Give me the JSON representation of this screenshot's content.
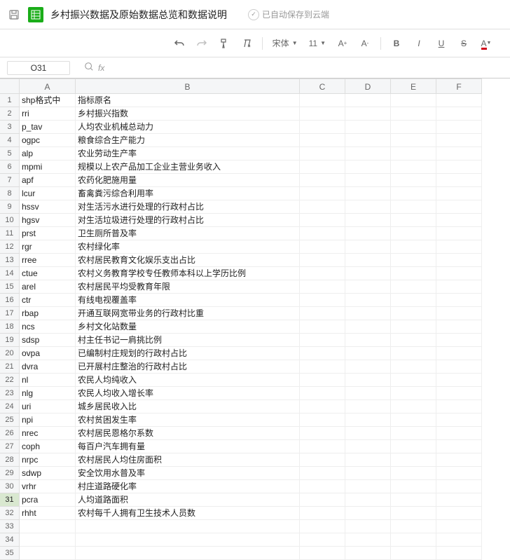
{
  "header": {
    "title": "乡村振兴数据及原始数据总览和数据说明",
    "cloud_status": "已自动保存到云端"
  },
  "toolbar": {
    "font_name": "宋体",
    "font_size": "11"
  },
  "formula_bar": {
    "cell_ref": "O31",
    "fx": "fx"
  },
  "columns": [
    "A",
    "B",
    "C",
    "D",
    "E",
    "F"
  ],
  "active_row": 31,
  "num_display_rows": 35,
  "rows": [
    {
      "a": "shp格式中",
      "b": "指标原名"
    },
    {
      "a": "rri",
      "b": "乡村振兴指数"
    },
    {
      "a": "p_tav",
      "b": "人均农业机械总动力"
    },
    {
      "a": "ogpc",
      "b": "粮食综合生产能力"
    },
    {
      "a": "alp",
      "b": "农业劳动生产率"
    },
    {
      "a": "mpmi",
      "b": "规模以上农产品加工企业主营业务收入"
    },
    {
      "a": "apf",
      "b": "农药化肥施用量"
    },
    {
      "a": "lcur",
      "b": "畜禽粪污综合利用率"
    },
    {
      "a": "hssv",
      "b": "对生活污水进行处理的行政村占比"
    },
    {
      "a": "hgsv",
      "b": "对生活垃圾进行处理的行政村占比"
    },
    {
      "a": "prst",
      "b": "卫生厕所普及率"
    },
    {
      "a": "rgr",
      "b": "农村绿化率"
    },
    {
      "a": "rree",
      "b": "农村居民教育文化娱乐支出占比"
    },
    {
      "a": "ctue",
      "b": "农村义务教育学校专任教师本科以上学历比例"
    },
    {
      "a": "arel",
      "b": "农村居民平均受教育年限"
    },
    {
      "a": "ctr",
      "b": "有线电视覆盖率"
    },
    {
      "a": "rbap",
      "b": "开通互联网宽带业务的行政村比重"
    },
    {
      "a": "ncs",
      "b": "乡村文化站数量"
    },
    {
      "a": "sdsp",
      "b": "村主任书记一肩挑比例"
    },
    {
      "a": "ovpa",
      "b": "已编制村庄规划的行政村占比"
    },
    {
      "a": "dvra",
      "b": "已开展村庄整治的行政村占比"
    },
    {
      "a": "nl",
      "b": "农民人均纯收入"
    },
    {
      "a": "nlg",
      "b": "农民人均收入增长率"
    },
    {
      "a": "uri",
      "b": "城乡居民收入比"
    },
    {
      "a": "npi",
      "b": "农村贫困发生率"
    },
    {
      "a": "nrec",
      "b": "农村居民恩格尔系数"
    },
    {
      "a": "coph",
      "b": "每百户汽车拥有量"
    },
    {
      "a": "nrpc",
      "b": "农村居民人均住房面积"
    },
    {
      "a": "sdwp",
      "b": "安全饮用水普及率"
    },
    {
      "a": "vrhr",
      "b": "村庄道路硬化率"
    },
    {
      "a": "pcra",
      "b": "人均道路面积"
    },
    {
      "a": "rhht",
      "b": "农村每千人拥有卫生技术人员数"
    }
  ]
}
